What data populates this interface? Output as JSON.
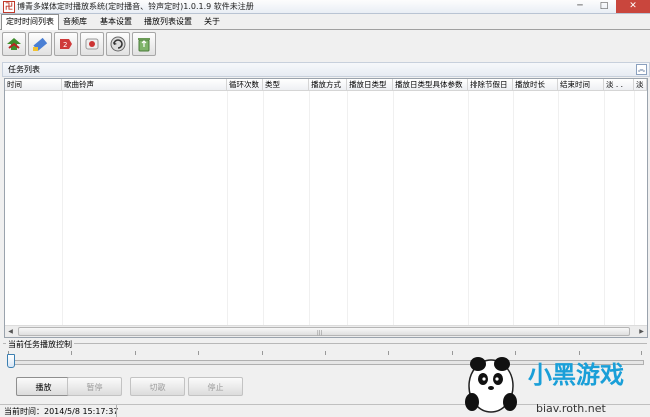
{
  "window": {
    "title": "博青多媒体定时播放系统(定时播音、铃声定时)1.0.1.9 软件未注册",
    "buttons": [
      "─",
      "□",
      "✕"
    ]
  },
  "menu": {
    "items": [
      "定时时间列表",
      "音频库",
      "基本设置",
      "播放列表设置",
      "关于"
    ]
  },
  "toolbar": {
    "icons": [
      "add-task-icon",
      "edit-task-icon",
      "copy-task-icon",
      "speaker-icon",
      "refresh-icon",
      "recycle-bin-icon"
    ]
  },
  "task_panel": {
    "title": "任务列表",
    "collapse_glyph": "︽",
    "columns": [
      "时间",
      "歌曲铃声",
      "循环次数",
      "类型",
      "播放方式",
      "播放日类型",
      "播放日类型具体参数",
      "排除节假日",
      "播放时长",
      "结束时间",
      "淡 . .",
      "淡"
    ],
    "rows": [],
    "scroll_grip": "|||"
  },
  "control_panel": {
    "title": "当前任务播放控制",
    "play_label": "播放",
    "pause_label": "暂停",
    "switch_label": "切歌",
    "stop_label": "停止",
    "progress": 0
  },
  "status": {
    "text": "当前时间：2014/5/8 15:17:37"
  },
  "watermark": {
    "brand": "小黑游戏",
    "url": "biav.roth.net"
  }
}
